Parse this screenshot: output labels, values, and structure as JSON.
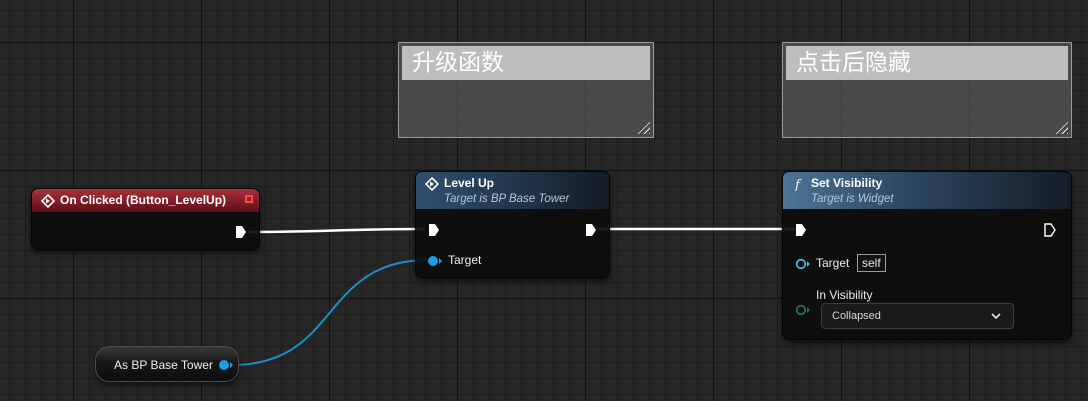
{
  "colors": {
    "exec_wire": "#ffffff",
    "object_wire": "#1a8fcf",
    "object_pin": "#1a9fe8",
    "widget_pin": "#46b6d8",
    "enum_pin": "#1f6f64",
    "event_header": "#8f2430",
    "function_header": "#3b5c7c"
  },
  "comments": [
    {
      "title": "升级函数"
    },
    {
      "title": "点击后隐藏"
    }
  ],
  "event_node": {
    "title": "On Clicked (Button_LevelUp)",
    "icon": "event-diamond-icon"
  },
  "level_up_node": {
    "title": "Level Up",
    "subtitle": "Target is BP Base Tower",
    "icon": "function-diamond-icon",
    "target_label": "Target"
  },
  "set_visibility_node": {
    "title": "Set Visibility",
    "subtitle": "Target is Widget",
    "icon": "function-f-icon",
    "target_label": "Target",
    "target_value": "self",
    "visibility_label": "In Visibility",
    "visibility_value": "Collapsed"
  },
  "cast_node": {
    "label": "As BP Base Tower"
  }
}
